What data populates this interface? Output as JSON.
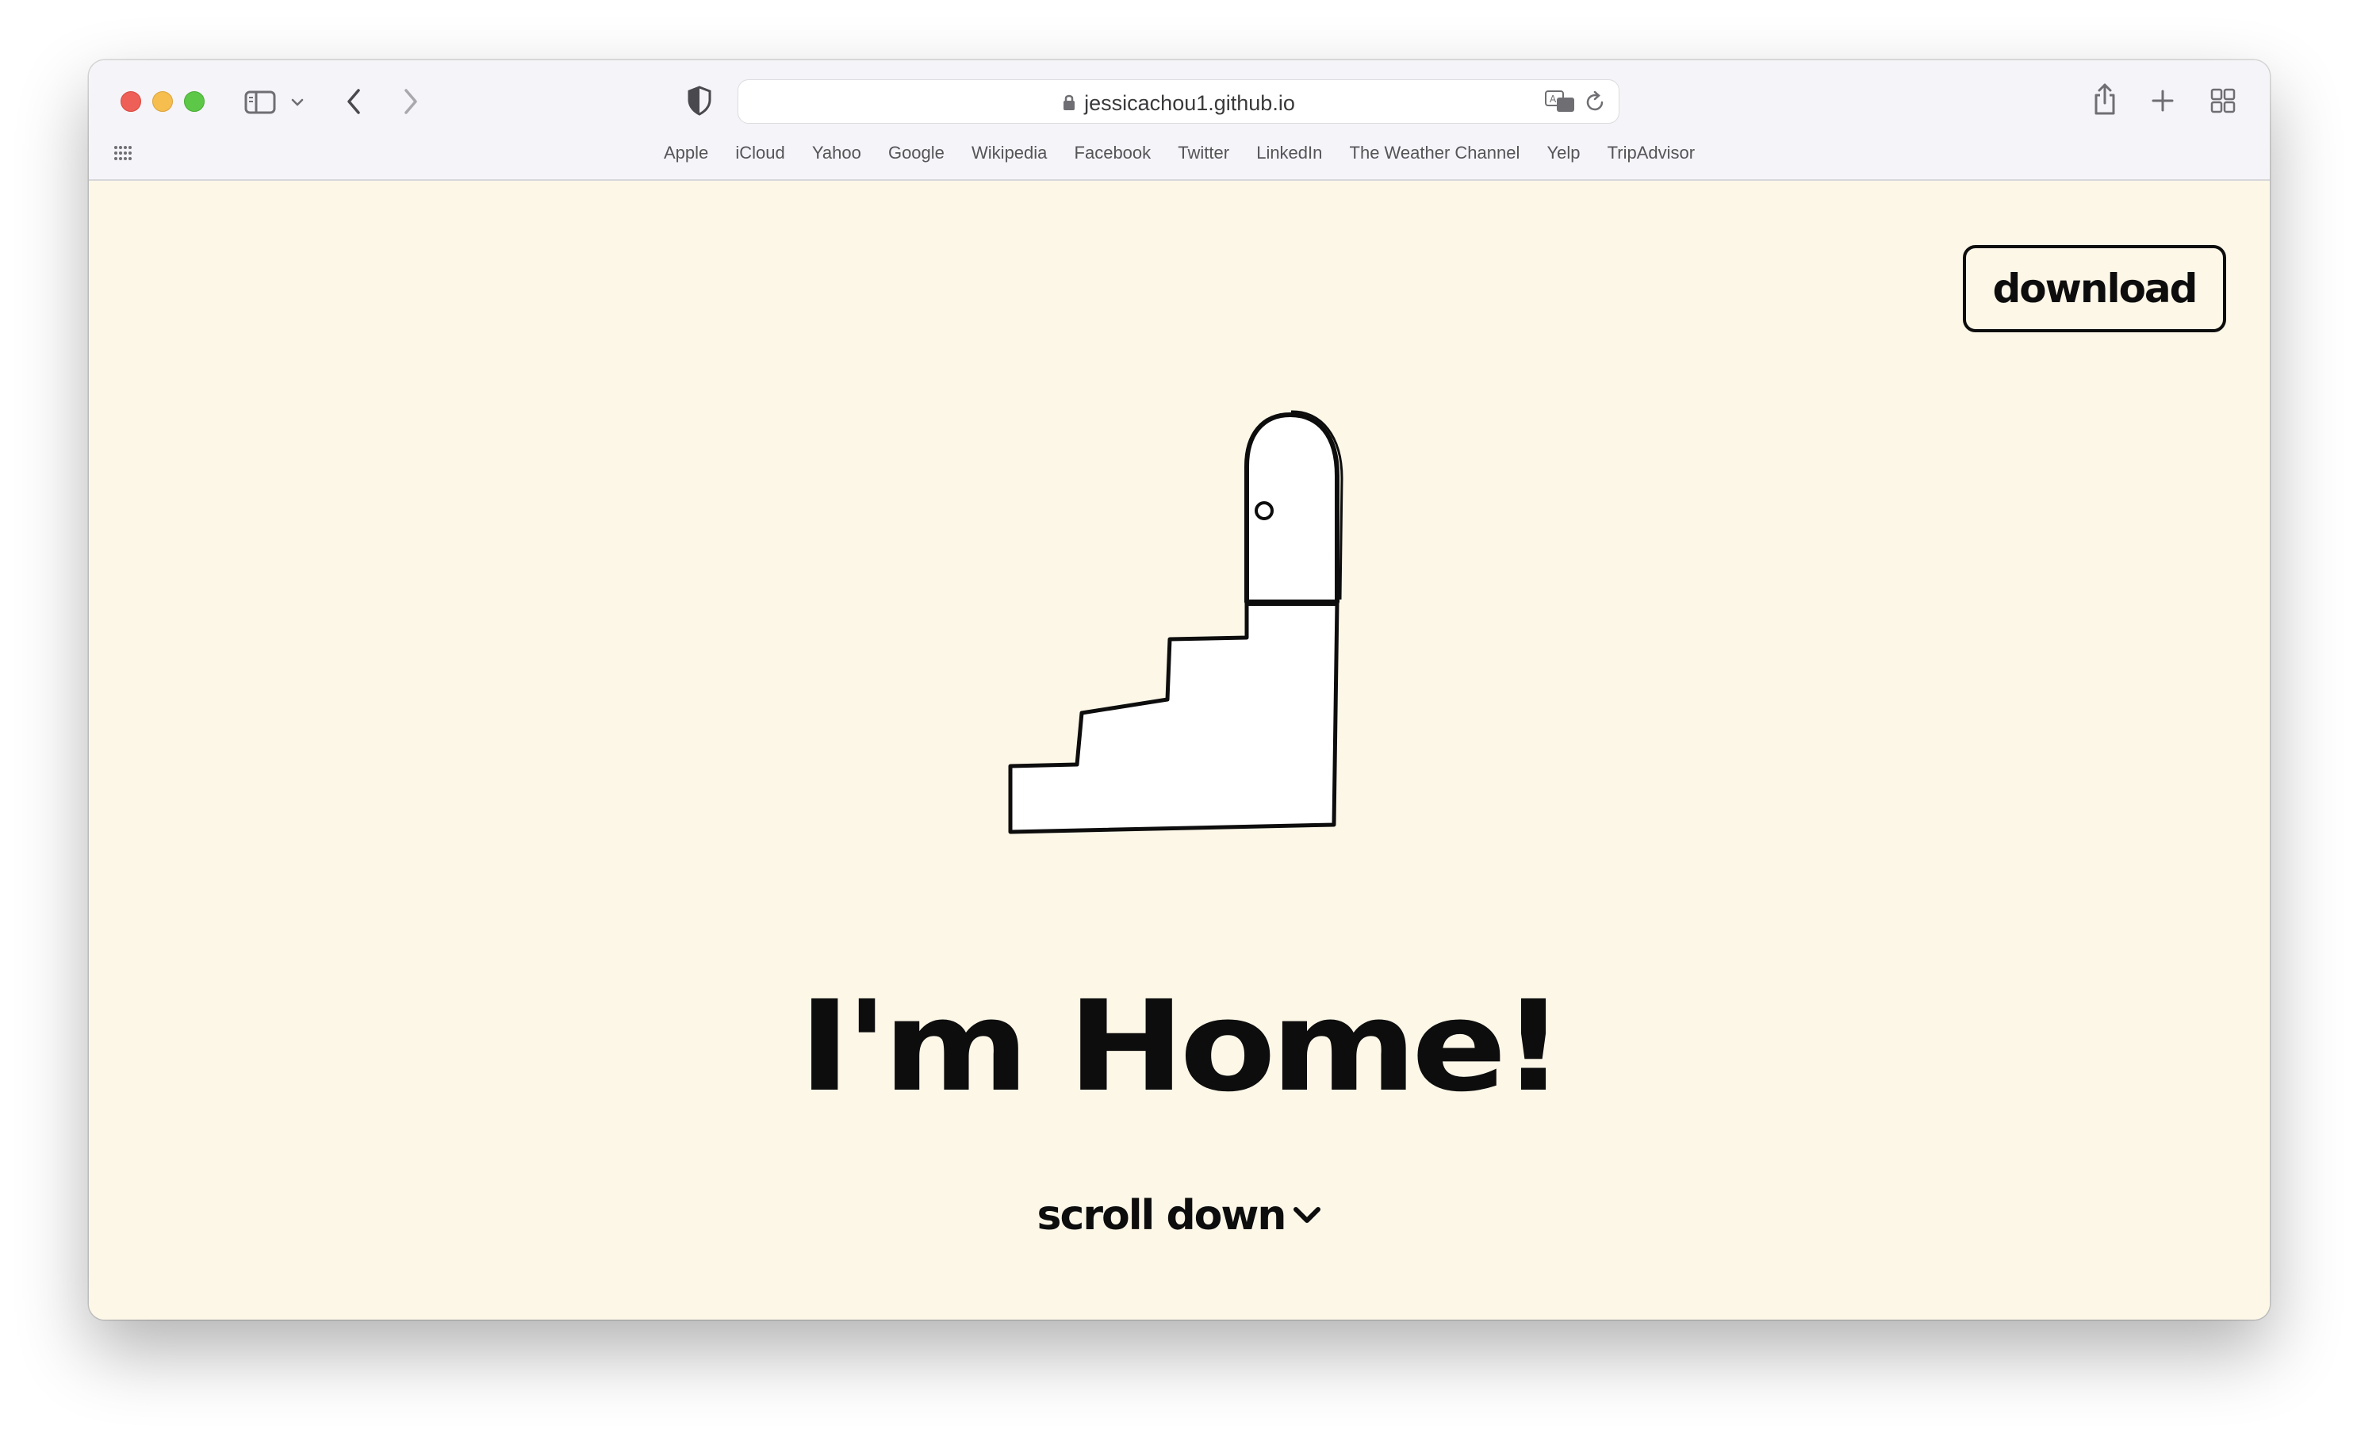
{
  "browser": {
    "url": "jessicachou1.github.io",
    "favorites": [
      "Apple",
      "iCloud",
      "Yahoo",
      "Google",
      "Wikipedia",
      "Facebook",
      "Twitter",
      "LinkedIn",
      "The Weather Channel",
      "Yelp",
      "TripAdvisor"
    ],
    "icons": [
      "sidebar-icon",
      "chevron-down-icon",
      "back-icon",
      "forward-icon",
      "shield-icon",
      "lock-icon",
      "translate-icon",
      "reload-icon",
      "share-icon",
      "new-tab-icon",
      "tab-overview-icon",
      "favorites-grid-icon"
    ]
  },
  "page": {
    "download_label": "download",
    "title": "I'm Home!",
    "scroll_label": "scroll down",
    "illustration": "stairs-with-door-illustration"
  },
  "colors": {
    "page_background": "#fdf7e8",
    "text": "#0d0d0d",
    "toolbar": "#f5f4f8"
  }
}
